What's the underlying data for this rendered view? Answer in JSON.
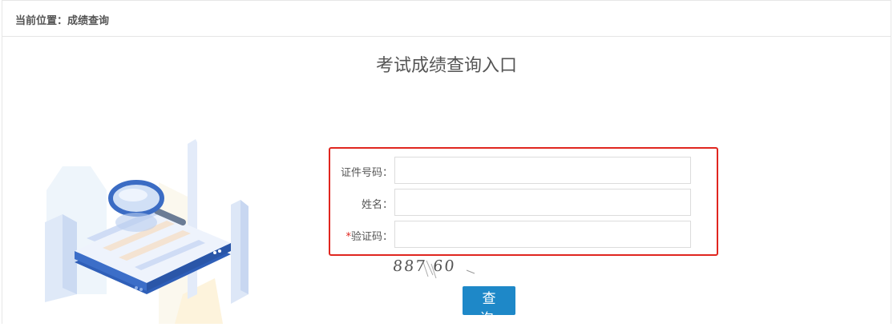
{
  "breadcrumb": {
    "text": "当前位置：成绩查询"
  },
  "page": {
    "title": "考试成绩查询入口"
  },
  "form": {
    "fields": [
      {
        "label": "证件号码：",
        "required": false,
        "value": ""
      },
      {
        "label": "姓名：",
        "required": false,
        "value": ""
      },
      {
        "label": "验证码：",
        "required": true,
        "required_mark": "*",
        "value": ""
      }
    ],
    "captcha_text": "887 60",
    "submit_label": "查 询"
  },
  "colors": {
    "accent": "#1e88c8",
    "highlight_border": "#e0261f",
    "required_mark": "#e0261f"
  },
  "icons": [
    "magnifier-illustration"
  ]
}
